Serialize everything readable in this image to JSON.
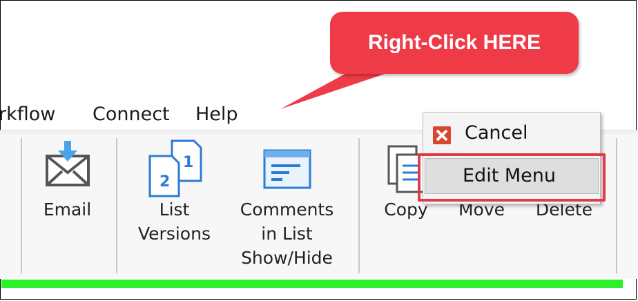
{
  "callout": {
    "text": "Right-Click HERE",
    "color": "#ef3a48"
  },
  "menubar": {
    "items": [
      "rkflow",
      "Connect",
      "Help"
    ]
  },
  "ribbon": {
    "buttons": [
      {
        "lines": [
          "Email"
        ],
        "icon": "email-icon"
      },
      {
        "lines": [
          "List",
          "Versions"
        ],
        "icon": "list-versions-icon"
      },
      {
        "lines": [
          "Comments",
          "in List",
          "Show/Hide"
        ],
        "icon": "comments-icon"
      },
      {
        "lines": [
          "Copy"
        ],
        "icon": "copy-icon"
      },
      {
        "lines": [
          "Move"
        ],
        "icon": "move-icon"
      },
      {
        "lines": [
          "Delete"
        ],
        "icon": "delete-icon"
      }
    ]
  },
  "context_menu": {
    "items": [
      {
        "label": "Cancel",
        "icon": "cancel-x-icon"
      },
      {
        "label": "Edit Menu"
      }
    ]
  },
  "colors": {
    "progress": "#2cf02c",
    "highlight": "#e33a4a",
    "accent_blue": "#2b7bd6"
  }
}
